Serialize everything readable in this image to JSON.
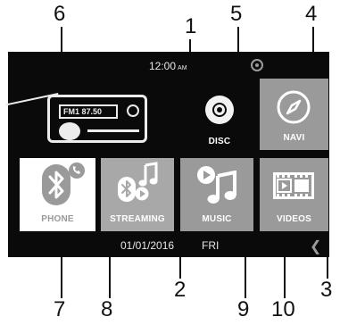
{
  "callouts": [
    "1",
    "2",
    "3",
    "4",
    "5",
    "6",
    "7",
    "8",
    "9",
    "10"
  ],
  "status_bar": {
    "time": "12:00",
    "ampm": "AM"
  },
  "radio": {
    "display": "FM1  87.50"
  },
  "tiles": {
    "disc": "DISC",
    "navi": "NAVI",
    "phone": "PHONE",
    "streaming": "STREAMING",
    "music": "MUSIC",
    "videos": "VIDEOS"
  },
  "footer": {
    "date": "01/01/2016",
    "day": "FRI"
  },
  "colors": {
    "screen_bg": "#0a0a0a",
    "tile_gray": "#9a9a9a",
    "tile_gray_light": "#a8a8a8",
    "icon_white": "#ffffff"
  },
  "icons": [
    "radio-icon",
    "disc-icon",
    "compass-icon",
    "bluetooth-icon",
    "music-note-icon",
    "film-icon",
    "back-arrow-icon",
    "status-icon"
  ]
}
